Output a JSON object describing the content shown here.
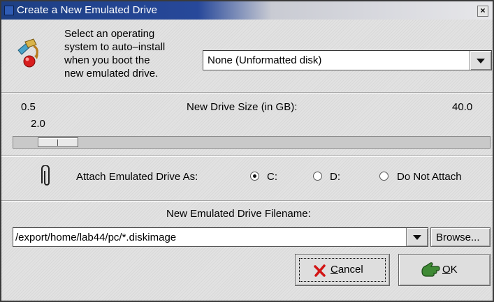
{
  "window": {
    "title": "Create a New Emulated Drive",
    "close_label": "×"
  },
  "os": {
    "prompt_lines": [
      "Select an operating",
      "system to auto–install",
      "when you boot the",
      "new emulated drive."
    ],
    "selected": "None (Unformatted disk)",
    "icon": "install-disk-icon"
  },
  "size": {
    "min_label": "0.5",
    "title": "New Drive Size (in GB):",
    "max_label": "40.0",
    "current_label": "2.0",
    "min": 0.5,
    "max": 40.0,
    "value": 2.0
  },
  "attach": {
    "icon": "paperclip-icon",
    "label": "Attach Emulated Drive As:",
    "options": [
      {
        "label": "C:",
        "selected": true
      },
      {
        "label": "D:",
        "selected": false
      },
      {
        "label": "Do Not Attach",
        "selected": false
      }
    ]
  },
  "file": {
    "label": "New Emulated Drive Filename:",
    "value": "/export/home/lab44/pc/*.diskimage",
    "browse_label": "Browse..."
  },
  "buttons": {
    "cancel": {
      "label": "Cancel",
      "mnemonic": "C",
      "rest": "ancel",
      "icon": "x-mark-icon"
    },
    "ok": {
      "label": "OK",
      "mnemonic": "O",
      "rest": "K",
      "icon": "pointing-hand-icon"
    }
  },
  "colors": {
    "titlebar": "#27489a",
    "cancel_icon": "#d21515",
    "ok_icon": "#3f8a35"
  }
}
